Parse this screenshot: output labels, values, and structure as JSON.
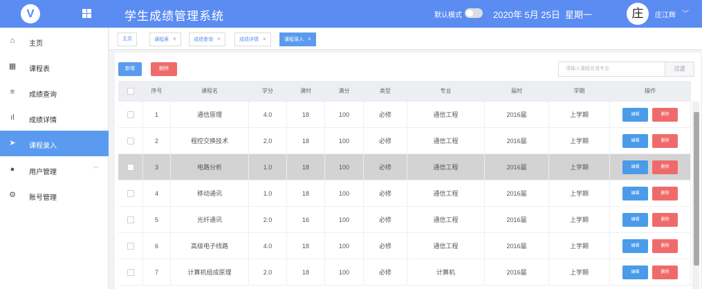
{
  "header": {
    "logo_text": "V",
    "title": "学生成绩管理系统",
    "mode_label": "默认模式",
    "date": "2020年 5月 25日",
    "weekday": "星期一",
    "avatar_char": "庄",
    "user_name": "庄江辉",
    "user_caret": "﹀",
    "brand_color": "#5b8cf2"
  },
  "sidebar": {
    "items": [
      {
        "label": "主页",
        "icon": "home-icon",
        "glyph": "⌂"
      },
      {
        "label": "课程表",
        "icon": "grid-icon",
        "glyph": "▦"
      },
      {
        "label": "成绩查询",
        "icon": "list-icon",
        "glyph": "≡"
      },
      {
        "label": "成绩详情",
        "icon": "bar-chart-icon",
        "glyph": "ıl"
      },
      {
        "label": "课程录入",
        "icon": "send-icon",
        "glyph": "➤"
      },
      {
        "label": "用户管理",
        "icon": "user-icon",
        "glyph": "●",
        "caret": "﹀"
      },
      {
        "label": "账号管理",
        "icon": "gear-icon",
        "glyph": "⚙"
      }
    ],
    "active_index": 4
  },
  "tabs": [
    {
      "label": "主页"
    },
    {
      "label": "课程表",
      "close": "×"
    },
    {
      "label": "成绩查询",
      "close": "×"
    },
    {
      "label": "成绩详情",
      "close": "×"
    },
    {
      "label": "课程录入",
      "close": "×",
      "active": true
    }
  ],
  "toolbar": {
    "add_label": "新增",
    "delete_label": "删除",
    "search_placeholder": "请输入课程名或专业",
    "filter_label": "过滤"
  },
  "table": {
    "headers": [
      "",
      "序号",
      "课程名",
      "学分",
      "课时",
      "满分",
      "类型",
      "专业",
      "届时",
      "学期",
      "操作"
    ],
    "edit_label": "编辑",
    "delete_label": "删除",
    "rows": [
      {
        "no": "1",
        "name": "通信原理",
        "credit": "4.0",
        "hours": "18",
        "full": "100",
        "type": "必修",
        "major": "通信工程",
        "year": "2016届",
        "term": "上学期"
      },
      {
        "no": "2",
        "name": "程控交换技术",
        "credit": "2.0",
        "hours": "18",
        "full": "100",
        "type": "必修",
        "major": "通信工程",
        "year": "2016届",
        "term": "上学期"
      },
      {
        "no": "3",
        "name": "电路分析",
        "credit": "1.0",
        "hours": "18",
        "full": "100",
        "type": "必修",
        "major": "通信工程",
        "year": "2016届",
        "term": "上学期",
        "highlight": true
      },
      {
        "no": "4",
        "name": "移动通讯",
        "credit": "1.0",
        "hours": "18",
        "full": "100",
        "type": "必修",
        "major": "通信工程",
        "year": "2016届",
        "term": "上学期"
      },
      {
        "no": "5",
        "name": "光纤通讯",
        "credit": "2.0",
        "hours": "16",
        "full": "100",
        "type": "必修",
        "major": "通信工程",
        "year": "2016届",
        "term": "上学期"
      },
      {
        "no": "6",
        "name": "高级电子线路",
        "credit": "4.0",
        "hours": "18",
        "full": "100",
        "type": "必修",
        "major": "通信工程",
        "year": "2016届",
        "term": "上学期"
      },
      {
        "no": "7",
        "name": "计算机组成原理",
        "credit": "2.0",
        "hours": "18",
        "full": "100",
        "type": "必修",
        "major": "计算机",
        "year": "2016届",
        "term": "上学期"
      }
    ]
  }
}
